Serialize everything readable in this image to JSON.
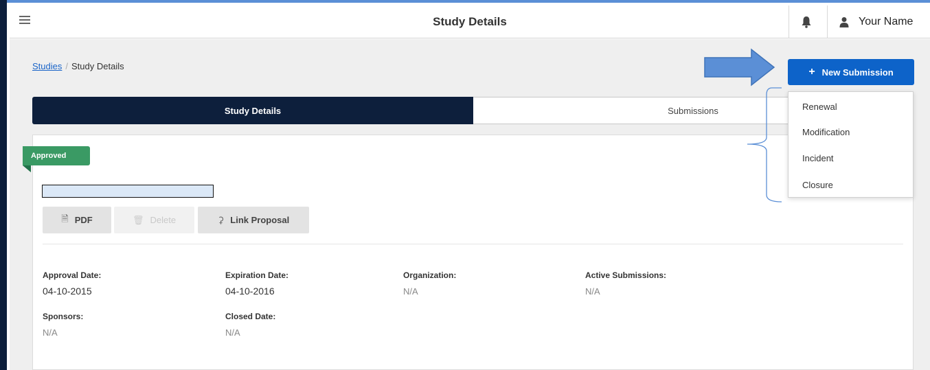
{
  "header": {
    "title": "Study Details",
    "user_name": "Your Name"
  },
  "breadcrumb": {
    "root": "Studies",
    "separator": "/",
    "current": "Study Details"
  },
  "new_submission": {
    "label": "New Submission",
    "icon": "plus-icon",
    "menu_items": [
      "Renewal",
      "Modification",
      "Incident",
      "Closure"
    ]
  },
  "tabs": [
    {
      "label": "Study Details",
      "active": true
    },
    {
      "label": "Submissions",
      "active": false
    }
  ],
  "status_badge": "Approved",
  "actions": {
    "pdf": "PDF",
    "delete": "Delete",
    "link_proposal": "Link Proposal"
  },
  "fields": {
    "approval_date": {
      "label": "Approval Date:",
      "value": "04-10-2015"
    },
    "expiration_date": {
      "label": "Expiration Date:",
      "value": "04-10-2016"
    },
    "organization": {
      "label": "Organization:",
      "value": "N/A"
    },
    "active_submissions": {
      "label": "Active Submissions:",
      "value": "N/A"
    },
    "sponsors": {
      "label": "Sponsors:",
      "value": "N/A"
    },
    "closed_date": {
      "label": "Closed Date:",
      "value": "N/A"
    }
  },
  "colors": {
    "primary": "#0d63c9",
    "nav_dark": "#0d1f3c",
    "approved": "#3a9a64",
    "annotation_arrow": "#5b8fd6"
  }
}
